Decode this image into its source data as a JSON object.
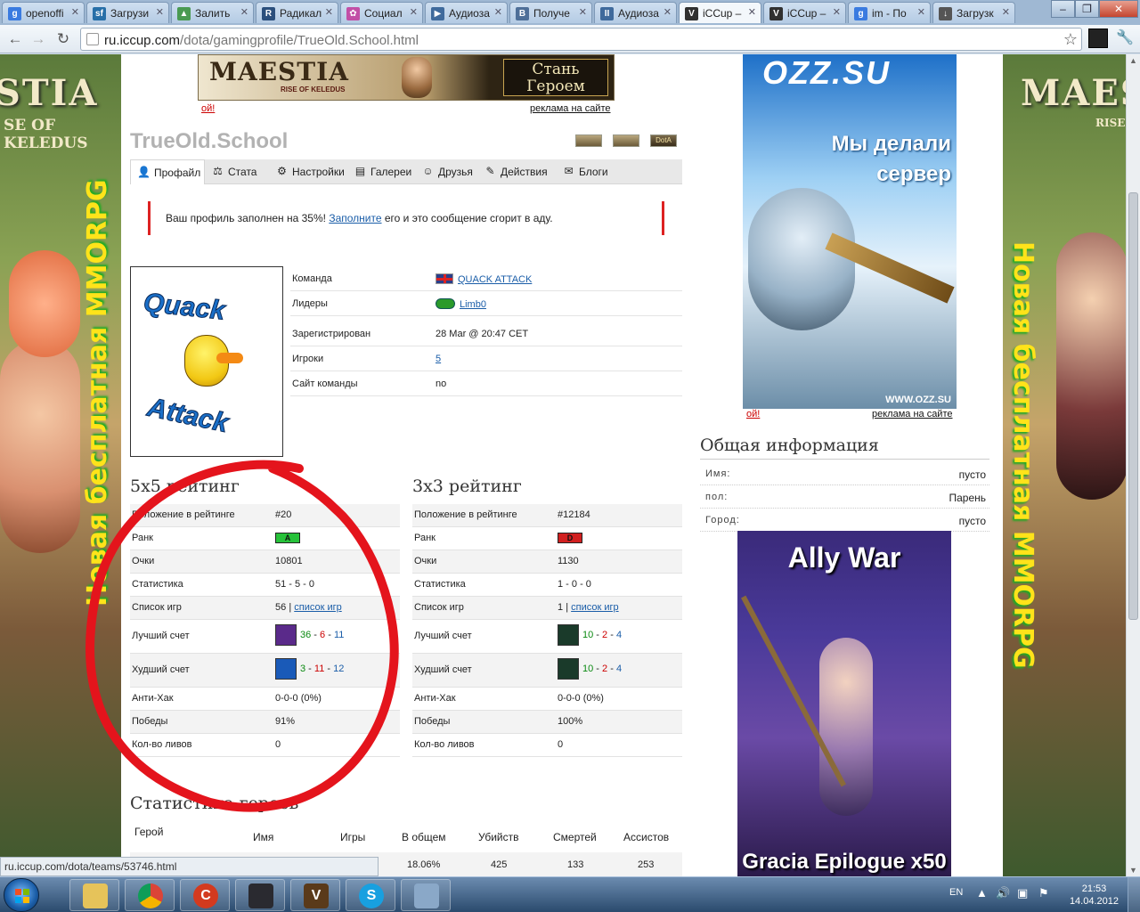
{
  "browser": {
    "tabs": [
      {
        "label": "openoffi",
        "fav": "google-icon",
        "color": "#3a7be0",
        "glyph": "g"
      },
      {
        "label": "Загрузи",
        "fav": "sourceforge-icon",
        "color": "#276fa8",
        "glyph": "sf"
      },
      {
        "label": "Залить",
        "fav": "image-host-icon",
        "color": "#4a9a52",
        "glyph": "▲"
      },
      {
        "label": "Радикал",
        "fav": "radikal-icon",
        "color": "#2b4f7c",
        "glyph": "R"
      },
      {
        "label": "Социал",
        "fav": "social-icon",
        "color": "#c24fa6",
        "glyph": "✿"
      },
      {
        "label": "Аудиоза",
        "fav": "audio-play-icon",
        "color": "#3f6a9c",
        "glyph": "▶"
      },
      {
        "label": "Получе",
        "fav": "vk-icon",
        "color": "#4e6f98",
        "glyph": "B"
      },
      {
        "label": "Аудиоза",
        "fav": "audio-pause-icon",
        "color": "#3f6a9c",
        "glyph": "II"
      },
      {
        "label": "iCCup –",
        "fav": "iccup-icon",
        "color": "#303030",
        "glyph": "V"
      },
      {
        "label": "iCCup –",
        "fav": "iccup-icon",
        "color": "#303030",
        "glyph": "V"
      },
      {
        "label": "im - По",
        "fav": "google-icon",
        "color": "#3a7be0",
        "glyph": "g"
      },
      {
        "label": "Загрузк",
        "fav": "download-icon",
        "color": "#555",
        "glyph": "↓"
      }
    ],
    "active_tab": 8,
    "url_host": "ru.iccup.com",
    "url_path": "/dota/gamingprofile/TrueOld.School.html",
    "status_text": "ru.iccup.com/dota/teams/53746.html"
  },
  "ads": {
    "top_banner_brand": "MAESTIA",
    "top_banner_sub": "RISE OF KELEDUS",
    "top_banner_cta_1": "Стань",
    "top_banner_cta_2": "Героем",
    "oi": "ой!",
    "ad_on_site": "реклама на сайте",
    "ozz_brand": "OZZ.SU",
    "ozz_text_1": "Мы делали",
    "ozz_text_2": "сервер",
    "ozz_url": "WWW.OZZ.SU",
    "left_banner_brand": "STIA",
    "left_banner_sub": "SE OF KELEDUS",
    "left_banner_vertical": "Новая бесплатная MMORPG",
    "right_banner_brand": "MAES",
    "right_banner_sub": "RISE",
    "right_banner_vertical": "Новая бесплатная MMORPG",
    "ally_title": "Ally War",
    "ally_sub": "Gracia Epilogue x50"
  },
  "profile": {
    "name": "TrueOld.School",
    "game_icons": [
      "sc-icon",
      "wc3-icon",
      "dota-icon"
    ],
    "dota_icon_label": "DotA",
    "tabs": [
      {
        "label": "Профайл",
        "icon": "user-icon",
        "glyph": "👤"
      },
      {
        "label": "Стата",
        "icon": "stats-icon",
        "glyph": "⚖"
      },
      {
        "label": "Настройки",
        "icon": "gear-icon",
        "glyph": "⚙"
      },
      {
        "label": "Галереи",
        "icon": "gallery-icon",
        "glyph": "▤"
      },
      {
        "label": "Друзья",
        "icon": "friends-icon",
        "glyph": "☺"
      },
      {
        "label": "Действия",
        "icon": "pencil-icon",
        "glyph": "✎"
      },
      {
        "label": "Блоги",
        "icon": "blog-icon",
        "glyph": "✉"
      }
    ],
    "notice_pre": "Ваш профиль заполнен на 35%!",
    "notice_link": "Заполните",
    "notice_post": "его и это сообщение сгорит в аду.",
    "team_logo_text_1": "Quack",
    "team_logo_text_2": "Attack"
  },
  "team_info": {
    "team_k": "Команда",
    "team_v": "QUACK ATTACK",
    "leaders_k": "Лидеры",
    "leaders_v": "Limb0",
    "reg_k": "Зарегистрирован",
    "reg_v": "28 Mar @ 20:47 CET",
    "players_k": "Игроки",
    "players_v": "5",
    "site_k": "Сайт команды",
    "site_v": "no"
  },
  "rating5": {
    "title": "5x5 рейтинг",
    "pos_k": "Положение в рейтинге",
    "pos_v": "#20",
    "rank_k": "Ранк",
    "rank_v": "A",
    "rank_color": "#27c23a",
    "points_k": "Очки",
    "points_v": "10801",
    "stats_k": "Статистика",
    "stats_v": "51 - 5 - 0",
    "games_k": "Список игр",
    "games_n": "56",
    "games_sep": "|",
    "games_link": "список игр",
    "best_k": "Лучший счет",
    "best_a": "36",
    "best_b": "6",
    "best_c": "11",
    "worst_k": "Худший счет",
    "worst_a": "3",
    "worst_b": "11",
    "worst_c": "12",
    "ah_k": "Анти-Хак",
    "ah_v": "0-0-0 (0%)",
    "win_k": "Победы",
    "win_v": "91%",
    "leave_k": "Кол-во ливов",
    "leave_v": "0"
  },
  "rating3": {
    "title": "3x3 рейтинг",
    "pos_k": "Положение в рейтинге",
    "pos_v": "#12184",
    "rank_k": "Ранк",
    "rank_v": "D",
    "rank_color": "#d12020",
    "points_k": "Очки",
    "points_v": "1130",
    "stats_k": "Статистика",
    "stats_v": "1 - 0 - 0",
    "games_k": "Список игр",
    "games_n": "1",
    "games_sep": "|",
    "games_link": "список игр",
    "best_k": "Лучший счет",
    "best_a": "10",
    "best_b": "2",
    "best_c": "4",
    "worst_k": "Худший счет",
    "worst_a": "10",
    "worst_b": "2",
    "worst_c": "4",
    "ah_k": "Анти-Хак",
    "ah_v": "0-0-0 (0%)",
    "win_k": "Победы",
    "win_v": "100%",
    "leave_k": "Кол-во ливов",
    "leave_v": "0"
  },
  "heroes": {
    "title": "Статистика героев",
    "cols": [
      "Герой",
      "Имя",
      "Игры",
      "В общем",
      "Убийств",
      "Смертей",
      "Ассистов"
    ],
    "row": {
      "total": "18.06%",
      "kills": "425",
      "deaths": "133",
      "assists": "253"
    }
  },
  "general": {
    "title": "Общая информация",
    "name_k": "Имя:",
    "name_v": "пусто",
    "sex_k": "пол:",
    "sex_v": "Парень",
    "city_k": "Город:",
    "city_v": "пусто"
  },
  "taskbar": {
    "lang": "EN",
    "time": "21:53",
    "date": "14.04.2012"
  }
}
